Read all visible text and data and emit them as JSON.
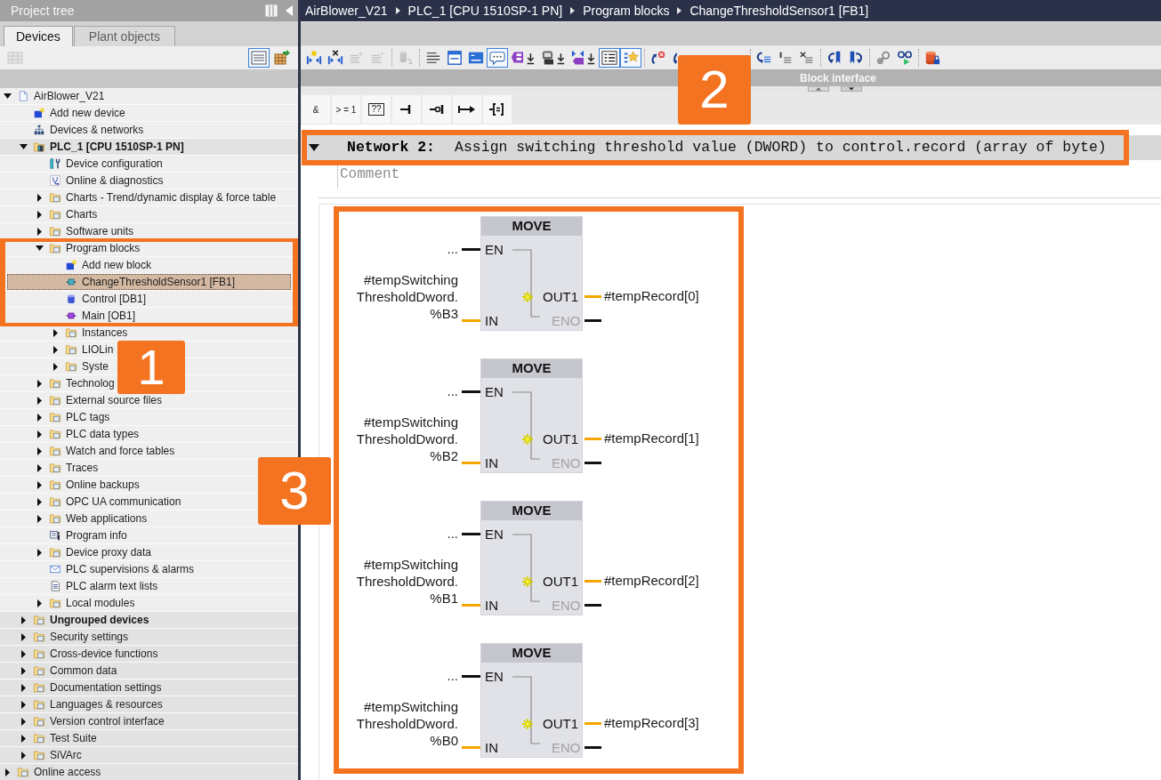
{
  "project_tree": {
    "title": "Project tree",
    "tabs": [
      {
        "label": "Devices",
        "selected": true
      },
      {
        "label": "Plant objects",
        "selected": false
      }
    ],
    "toolbar": [
      {
        "kind": "overview",
        "on": false,
        "disabled": true
      },
      {
        "kind": "details",
        "on": true,
        "disabled": false
      },
      {
        "kind": "export",
        "on": false,
        "disabled": false
      }
    ],
    "items": [
      {
        "label": "AirBlower_V21",
        "kind": "project",
        "expanded": true,
        "selected": false,
        "children": [
          {
            "label": "Add new device",
            "kind": "add",
            "selected": false
          },
          {
            "label": "Devices & networks",
            "kind": "network",
            "selected": false
          },
          {
            "label": "PLC_1 [CPU 1510SP-1 PN]",
            "kind": "device",
            "expanded": true,
            "selected": false,
            "bold": true,
            "shaded": true,
            "children": [
              {
                "label": "Device configuration",
                "kind": "tool",
                "selected": false
              },
              {
                "label": "Online & diagnostics",
                "kind": "diagnostics",
                "selected": false
              },
              {
                "label": "Charts - Trend/dynamic display & force table",
                "kind": "folder",
                "expanded": false,
                "selected": false
              },
              {
                "label": "Charts",
                "kind": "folder",
                "expanded": false,
                "selected": false
              },
              {
                "label": "Software units",
                "kind": "folder",
                "expanded": false,
                "selected": false
              },
              {
                "label": "Program blocks",
                "kind": "folder",
                "expanded": true,
                "selected": false,
                "children": [
                  {
                    "label": "Add new block",
                    "kind": "add",
                    "selected": false
                  },
                  {
                    "label": "ChangeThresholdSensor1 [FB1]",
                    "kind": "fb",
                    "selected": true
                  },
                  {
                    "label": "Control [DB1]",
                    "kind": "db",
                    "selected": false
                  },
                  {
                    "label": "Main [OB1]",
                    "kind": "ob",
                    "selected": false
                  },
                  {
                    "label": "Instances",
                    "kind": "folder",
                    "expanded": false,
                    "selected": false
                  },
                  {
                    "label": "LIOLin",
                    "kind": "folder",
                    "expanded": false,
                    "selected": false
                  },
                  {
                    "label": "Syste",
                    "kind": "folder",
                    "expanded": false,
                    "selected": false
                  }
                ]
              },
              {
                "label": "Technolog",
                "kind": "folder",
                "expanded": false,
                "selected": false
              },
              {
                "label": "External source files",
                "kind": "folder",
                "expanded": false,
                "selected": false
              },
              {
                "label": "PLC tags",
                "kind": "folder",
                "expanded": false,
                "selected": false
              },
              {
                "label": "PLC data types",
                "kind": "folder",
                "expanded": false,
                "selected": false
              },
              {
                "label": "Watch and force tables",
                "kind": "folder",
                "expanded": false,
                "selected": false
              },
              {
                "label": "Traces",
                "kind": "folder",
                "expanded": false,
                "selected": false
              },
              {
                "label": "Online backups",
                "kind": "folder",
                "expanded": false,
                "selected": false
              },
              {
                "label": "OPC UA communication",
                "kind": "folder",
                "expanded": false,
                "selected": false
              },
              {
                "label": "Web applications",
                "kind": "folder",
                "expanded": false,
                "selected": false
              },
              {
                "label": "Program info",
                "kind": "info",
                "selected": false
              },
              {
                "label": "Device proxy data",
                "kind": "folder",
                "expanded": false,
                "selected": false
              },
              {
                "label": "PLC supervisions & alarms",
                "kind": "envelope",
                "selected": false
              },
              {
                "label": "PLC alarm text lists",
                "kind": "list",
                "selected": false
              },
              {
                "label": "Local modules",
                "kind": "folder",
                "expanded": false,
                "selected": false
              }
            ]
          },
          {
            "label": "Ungrouped devices",
            "kind": "folder",
            "expanded": false,
            "selected": false,
            "bold": true,
            "shaded": true
          },
          {
            "label": "Security settings",
            "kind": "folder",
            "expanded": false,
            "selected": false,
            "shaded": true
          },
          {
            "label": "Cross-device functions",
            "kind": "folder",
            "expanded": false,
            "selected": false,
            "shaded": true
          },
          {
            "label": "Common data",
            "kind": "folder",
            "expanded": false,
            "selected": false,
            "shaded": true
          },
          {
            "label": "Documentation settings",
            "kind": "folder",
            "expanded": false,
            "selected": false,
            "shaded": true
          },
          {
            "label": "Languages & resources",
            "kind": "folder",
            "expanded": false,
            "selected": false,
            "shaded": true
          },
          {
            "label": "Version control interface",
            "kind": "folder",
            "expanded": false,
            "selected": false,
            "shaded": true
          },
          {
            "label": "Test Suite",
            "kind": "folder",
            "expanded": false,
            "selected": false,
            "shaded": true
          },
          {
            "label": "SiVArc",
            "kind": "folder",
            "expanded": false,
            "selected": false,
            "shaded": true
          }
        ]
      },
      {
        "label": "Online access",
        "kind": "folder",
        "expanded": false,
        "selected": false,
        "shaded": true
      }
    ]
  },
  "editor": {
    "breadcrumb": [
      "AirBlower_V21",
      "PLC_1 [CPU 1510SP-1 PN]",
      "Program blocks",
      "ChangeThresholdSensor1 [FB1]"
    ],
    "toolbar": [
      [
        {
          "kind": "network-add",
          "on": false,
          "disabled": false
        },
        {
          "kind": "network-delete",
          "on": false,
          "disabled": false
        },
        {
          "kind": "lines-sparkle",
          "on": false,
          "disabled": true
        },
        {
          "kind": "lines-sparkle",
          "on": false,
          "disabled": true
        }
      ],
      [
        {
          "kind": "cylinder-arrow",
          "on": false,
          "disabled": true
        }
      ],
      [
        {
          "kind": "lines",
          "on": false,
          "disabled": false
        },
        {
          "kind": "window",
          "on": false,
          "disabled": false
        },
        {
          "kind": "panel",
          "on": false,
          "disabled": false
        },
        {
          "kind": "comment",
          "on": true,
          "disabled": false
        },
        {
          "kind": "tag-download",
          "on": false,
          "disabled": false
        },
        {
          "kind": "screen-download",
          "on": false,
          "disabled": false
        },
        {
          "kind": "bracket-download",
          "on": false,
          "disabled": false
        },
        {
          "kind": "list",
          "on": true,
          "disabled": false
        },
        {
          "kind": "favorites",
          "on": true,
          "disabled": false
        }
      ],
      [
        {
          "kind": "refresh-error",
          "on": false,
          "disabled": false
        },
        {
          "kind": "curved-arrow",
          "on": false,
          "disabled": false
        }
      ],
      [
        {
          "kind": "arrow-lines",
          "on": false,
          "disabled": false
        },
        {
          "kind": "bar-lines",
          "on": false,
          "disabled": false
        },
        {
          "kind": "cross-lines",
          "on": false,
          "disabled": false
        }
      ],
      [
        {
          "kind": "bookmark-prev",
          "on": false,
          "disabled": false
        },
        {
          "kind": "bookmark-next",
          "on": false,
          "disabled": false
        }
      ],
      [
        {
          "kind": "magnifier",
          "on": false,
          "disabled": false
        },
        {
          "kind": "glasses-play",
          "on": false,
          "disabled": false
        }
      ],
      [
        {
          "kind": "cylinder-lock",
          "on": false,
          "disabled": false
        }
      ]
    ],
    "block_interface": {
      "label": "Block interface"
    },
    "instruction_bar": [
      {
        "kind": "text",
        "label": "&"
      },
      {
        "kind": "text",
        "label": "> = 1"
      },
      {
        "kind": "box",
        "label": "??"
      },
      {
        "kind": "contact"
      },
      {
        "kind": "negated-contact"
      },
      {
        "kind": "assignment"
      },
      {
        "kind": "coil"
      }
    ],
    "network": {
      "expanded": true,
      "title": "Network 2:",
      "description": "Assign switching threshold value (DWORD) to control.record (array of byte)",
      "comment": {
        "placeholder": "Comment"
      },
      "boxes": [
        {
          "title": "MOVE",
          "en_operand": "...",
          "en_pin": "EN",
          "in_pin": "IN",
          "out_pin": "OUT1",
          "eno_pin": "ENO",
          "eno_enabled": false,
          "in_operand": [
            "#tempSwitching",
            "ThresholdDword.",
            "%B3"
          ],
          "out_operand": "#tempRecord[0]"
        },
        {
          "title": "MOVE",
          "en_operand": "...",
          "en_pin": "EN",
          "in_pin": "IN",
          "out_pin": "OUT1",
          "eno_pin": "ENO",
          "eno_enabled": false,
          "in_operand": [
            "#tempSwitching",
            "ThresholdDword.",
            "%B2"
          ],
          "out_operand": "#tempRecord[1]"
        },
        {
          "title": "MOVE",
          "en_operand": "...",
          "en_pin": "EN",
          "in_pin": "IN",
          "out_pin": "OUT1",
          "eno_pin": "ENO",
          "eno_enabled": false,
          "in_operand": [
            "#tempSwitching",
            "ThresholdDword.",
            "%B1"
          ],
          "out_operand": "#tempRecord[2]"
        },
        {
          "title": "MOVE",
          "en_operand": "...",
          "en_pin": "EN",
          "in_pin": "IN",
          "out_pin": "OUT1",
          "eno_pin": "ENO",
          "eno_enabled": false,
          "in_operand": [
            "#tempSwitching",
            "ThresholdDword.",
            "%B0"
          ],
          "out_operand": "#tempRecord[3]"
        }
      ]
    }
  },
  "callouts": [
    {
      "label": "1"
    },
    {
      "label": "2"
    },
    {
      "label": "3"
    }
  ]
}
